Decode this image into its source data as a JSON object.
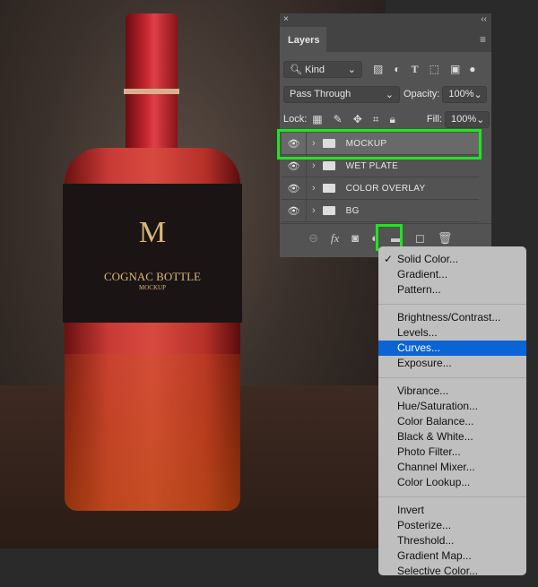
{
  "photo": {
    "logo_text": {
      "monogram": "M",
      "title": "COGNAC BOTTLE",
      "subtitle": "MOCKUP"
    }
  },
  "panel": {
    "close": "×",
    "collapse": "‹‹",
    "tab": "Layers",
    "menu_icon": "hamburger-icon",
    "filter": {
      "label": "Kind",
      "icons": [
        "image-icon",
        "adjustment-icon",
        "type-icon",
        "shape-icon",
        "smart-object-icon"
      ]
    },
    "blend_mode": "Pass Through",
    "opacity_label": "Opacity:",
    "opacity": "100%",
    "lock_label": "Lock:",
    "fill_label": "Fill:",
    "fill": "100%",
    "layers": [
      {
        "name": "MOCKUP",
        "selected": true
      },
      {
        "name": "WET PLATE"
      },
      {
        "name": "COLOR OVERLAY"
      },
      {
        "name": "BG"
      }
    ],
    "footer_icons": [
      "link-icon",
      "fx-icon",
      "mask-icon",
      "adjustment-layer-icon",
      "group-icon",
      "new-layer-icon",
      "trash-icon"
    ],
    "highlight_color": "#1ee61e"
  },
  "menu": {
    "groups": [
      [
        {
          "label": "Solid Color...",
          "checked": true
        },
        {
          "label": "Gradient..."
        },
        {
          "label": "Pattern..."
        }
      ],
      [
        {
          "label": "Brightness/Contrast..."
        },
        {
          "label": "Levels..."
        },
        {
          "label": "Curves...",
          "active": true
        },
        {
          "label": "Exposure..."
        }
      ],
      [
        {
          "label": "Vibrance..."
        },
        {
          "label": "Hue/Saturation..."
        },
        {
          "label": "Color Balance..."
        },
        {
          "label": "Black & White..."
        },
        {
          "label": "Photo Filter..."
        },
        {
          "label": "Channel Mixer..."
        },
        {
          "label": "Color Lookup..."
        }
      ],
      [
        {
          "label": "Invert"
        },
        {
          "label": "Posterize..."
        },
        {
          "label": "Threshold..."
        },
        {
          "label": "Gradient Map..."
        },
        {
          "label": "Selective Color..."
        }
      ]
    ],
    "checkmark": "✓",
    "active_color": "#0a64d6"
  }
}
